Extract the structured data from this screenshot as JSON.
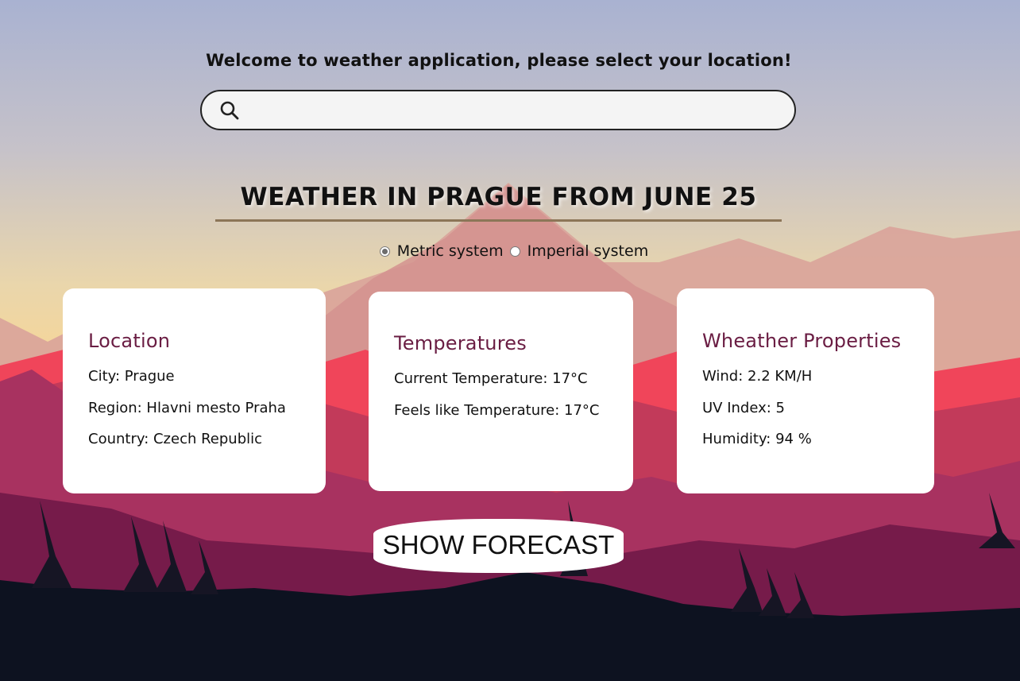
{
  "header": {
    "welcome_text": "Welcome to weather application, please select your location!"
  },
  "search": {
    "value": "",
    "placeholder": ""
  },
  "main": {
    "title": "WEATHER IN PRAGUE FROM JUNE 25"
  },
  "units": {
    "options": [
      {
        "label": "Metric system",
        "selected": true
      },
      {
        "label": "Imperial system",
        "selected": false
      }
    ]
  },
  "cards": {
    "location": {
      "heading": "Location",
      "lines": [
        "City: Prague",
        "Region: Hlavni mesto Praha",
        "Country: Czech Republic"
      ]
    },
    "temperatures": {
      "heading": "Temperatures",
      "lines": [
        "Current Temperature: 17°C",
        "Feels like Temperature: 17°C"
      ]
    },
    "properties": {
      "heading": "Wheather Properties",
      "lines": [
        "Wind: 2.2 KM/H",
        "UV Index: 5",
        "Humidity: 94 %"
      ]
    }
  },
  "forecast_button": {
    "label": "SHOW FORECAST"
  },
  "colors": {
    "card_heading": "#6a1d43",
    "underline": "#8c7658",
    "sky_top": "#a9b2d1",
    "sky_bottom": "#f6d49a",
    "ground": "#0d1220"
  }
}
